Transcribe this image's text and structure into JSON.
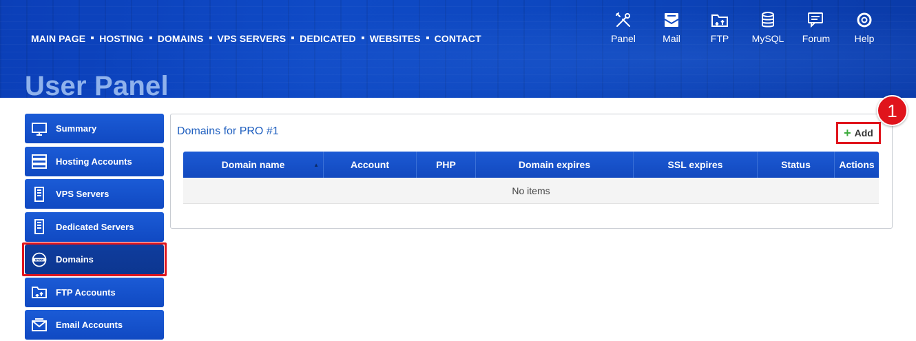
{
  "nav": {
    "items": [
      "MAIN PAGE",
      "HOSTING",
      "DOMAINS",
      "VPS SERVERS",
      "DEDICATED",
      "WEBSITES",
      "CONTACT"
    ]
  },
  "tools": [
    {
      "label": "Panel",
      "icon": "tools-icon"
    },
    {
      "label": "Mail",
      "icon": "mail-icon"
    },
    {
      "label": "FTP",
      "icon": "ftp-folder-icon"
    },
    {
      "label": "MySQL",
      "icon": "database-icon"
    },
    {
      "label": "Forum",
      "icon": "forum-icon"
    },
    {
      "label": "Help",
      "icon": "lifebuoy-icon"
    }
  ],
  "page": {
    "title": "User Panel"
  },
  "sidebar": {
    "items": [
      {
        "label": "Summary",
        "icon": "monitor-icon"
      },
      {
        "label": "Hosting Accounts",
        "icon": "server-rack-icon"
      },
      {
        "label": "VPS Servers",
        "icon": "server-tower-icon"
      },
      {
        "label": "Dedicated Servers",
        "icon": "server-tower-icon"
      },
      {
        "label": "Domains",
        "icon": "www-globe-icon",
        "active": true
      },
      {
        "label": "FTP Accounts",
        "icon": "ftp-folder-icon"
      },
      {
        "label": "Email Accounts",
        "icon": "email-icon"
      }
    ]
  },
  "panel": {
    "title": "Domains for PRO #1",
    "add_label": "Add",
    "badge": "1",
    "columns": [
      "Domain name",
      "Account",
      "PHP",
      "Domain expires",
      "SSL expires",
      "Status",
      "Actions"
    ],
    "sort_indicator": "▲",
    "empty_text": "No items"
  },
  "colors": {
    "brand_blue": "#1049c2",
    "highlight_red": "#e0141c",
    "add_green": "#3cab3c",
    "title_blue": "#1f5fbf"
  }
}
